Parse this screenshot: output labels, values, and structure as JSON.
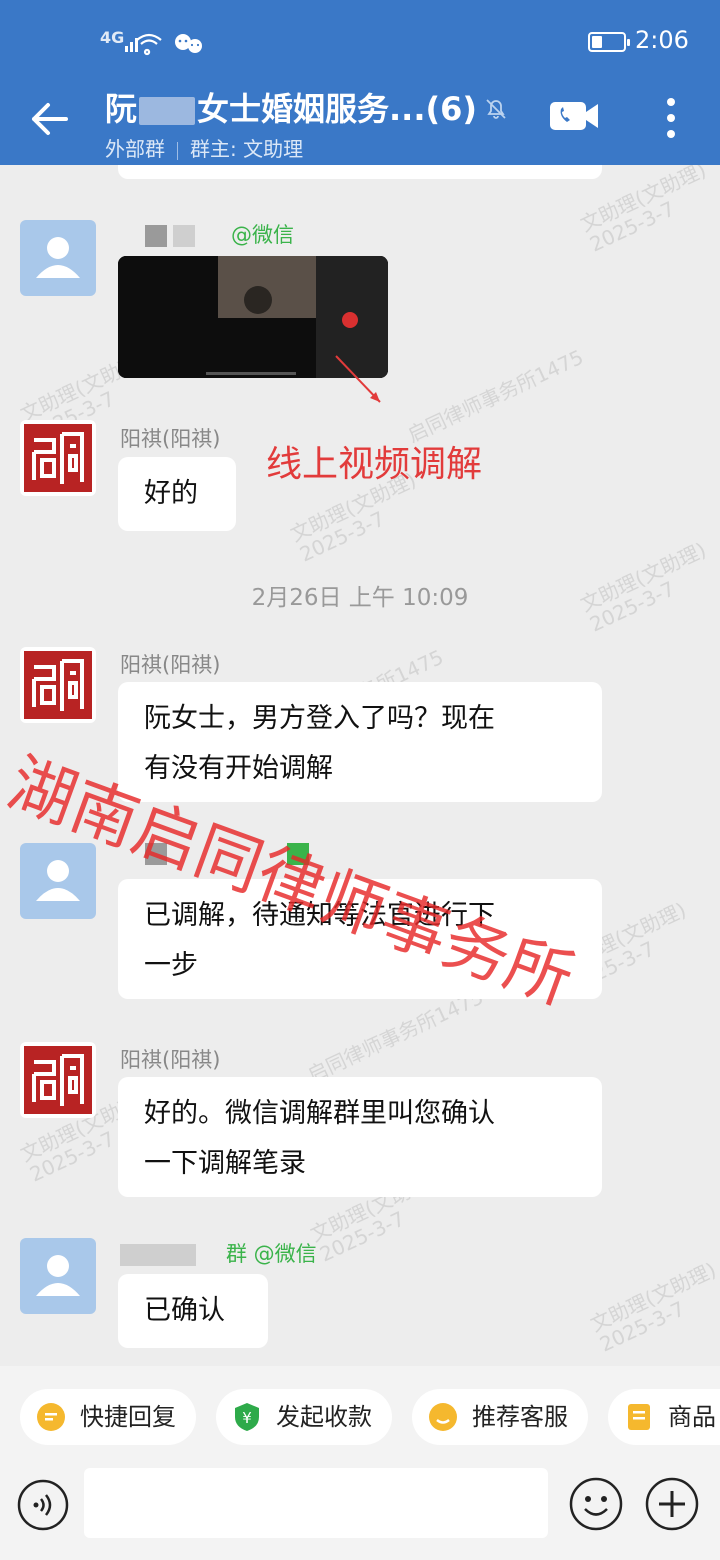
{
  "status": {
    "network": "4G",
    "time": "2:06"
  },
  "header": {
    "title_prefix": "阮",
    "title_suffix": "女士婚姻服务...(6)",
    "group_type": "外部群",
    "owner_label": "群主: 文助理"
  },
  "messages": [
    {
      "sender_suffix": "@微信",
      "kind": "video"
    },
    {
      "sender": "阳祺(阳祺)",
      "text": "好的"
    },
    {
      "sender": "阳祺(阳祺)",
      "text_line1": "阮女士，男方登入了吗？现在",
      "text_line2": "有没有开始调解"
    },
    {
      "sender_suffix": "",
      "text_line1": "已调解，待通知等法官进行下",
      "text_line2": "一步"
    },
    {
      "sender": "阳祺(阳祺)",
      "text_line1": "好的。微信调解群里叫您确认",
      "text_line2": "一下调解笔录"
    },
    {
      "sender_suffix": "群 @微信",
      "text": "已确认"
    }
  ],
  "timestamp": "2月26日  上午 10:09",
  "annotation": "线上视频调解",
  "stamp_text": "湖南启同律师事务所",
  "watermarks": [
    "文助理(文助理)",
    "2025-3-7",
    "启同律师事务所1475"
  ],
  "quick_actions": [
    {
      "label": "快捷回复",
      "icon": "quick-reply-icon",
      "color": "#f5b82e"
    },
    {
      "label": "发起收款",
      "icon": "payment-icon",
      "color": "#2eaa4a"
    },
    {
      "label": "推荐客服",
      "icon": "service-icon",
      "color": "#f5b82e"
    },
    {
      "label": "商品",
      "icon": "product-icon",
      "color": "#f5b82e"
    }
  ],
  "input": {
    "placeholder": ""
  },
  "colors": {
    "header": "#3a78c7",
    "wechat_green": "#3ab34a",
    "annotation_red": "#e23b3b"
  }
}
